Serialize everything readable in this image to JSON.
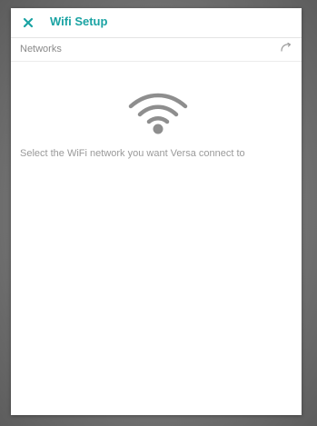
{
  "dialog": {
    "title": "Wifi Setup",
    "close_icon": "close-icon",
    "accent_color": "#1aa3a3"
  },
  "networks": {
    "label": "Networks",
    "refresh_icon": "refresh-icon"
  },
  "empty_state": {
    "icon": "wifi-icon",
    "message": "Select the WiFi network you want Versa connect to"
  }
}
